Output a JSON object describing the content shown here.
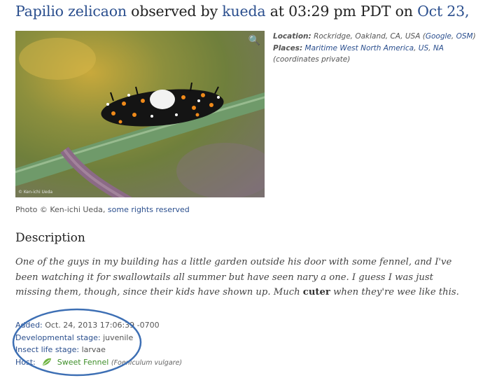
{
  "header": {
    "taxon": "Papilio zelicaon",
    "observed_by": "observed by",
    "user": "kueda",
    "at_time": "at 03:29 pm PDT on",
    "date": "Oct 23,"
  },
  "photo": {
    "zoom_icon": "magnifier-icon",
    "watermark": "© Ken-ichi Ueda"
  },
  "meta": {
    "location_label": "Location:",
    "location_value": "Rockridge, Oakland, CA, USA",
    "google_link": "Google",
    "osm_link": "OSM",
    "places_label": "Places:",
    "place_1": "Maritime West North America",
    "place_2": "US",
    "place_3": "NA",
    "coords": "(coordinates private)"
  },
  "photo_credit": {
    "text": "Photo © Ken-ichi Ueda,",
    "rights_link": "some rights reserved"
  },
  "description": {
    "heading": "Description",
    "line1": "One of the guys in my building has a little garden outside his door with some fennel, and I've",
    "line2": "been watching it for swallowtails all summer but have seen nary a one. I guess I was just",
    "line3_pre": "missing them, though, since their kids have shown up. Much",
    "line3_bold": "cuter",
    "line3_post": "when they're wee like this."
  },
  "details": {
    "added_label": "Added:",
    "added_value": "Oct. 24, 2013 17:06:39 -0700",
    "dev_label": "Developmental stage:",
    "dev_value": "juvenile",
    "insect_label": "Insect life stage:",
    "insect_value": "larvae",
    "host_label": "Host:",
    "host_icon": "leaf-icon",
    "host_value": "Sweet Fennel",
    "host_sci": "(Foeniculum vulgare)"
  },
  "colors": {
    "link": "#2b4f8e",
    "annotation_circle": "#3d6fb4",
    "host_link": "#3f8f2a"
  }
}
